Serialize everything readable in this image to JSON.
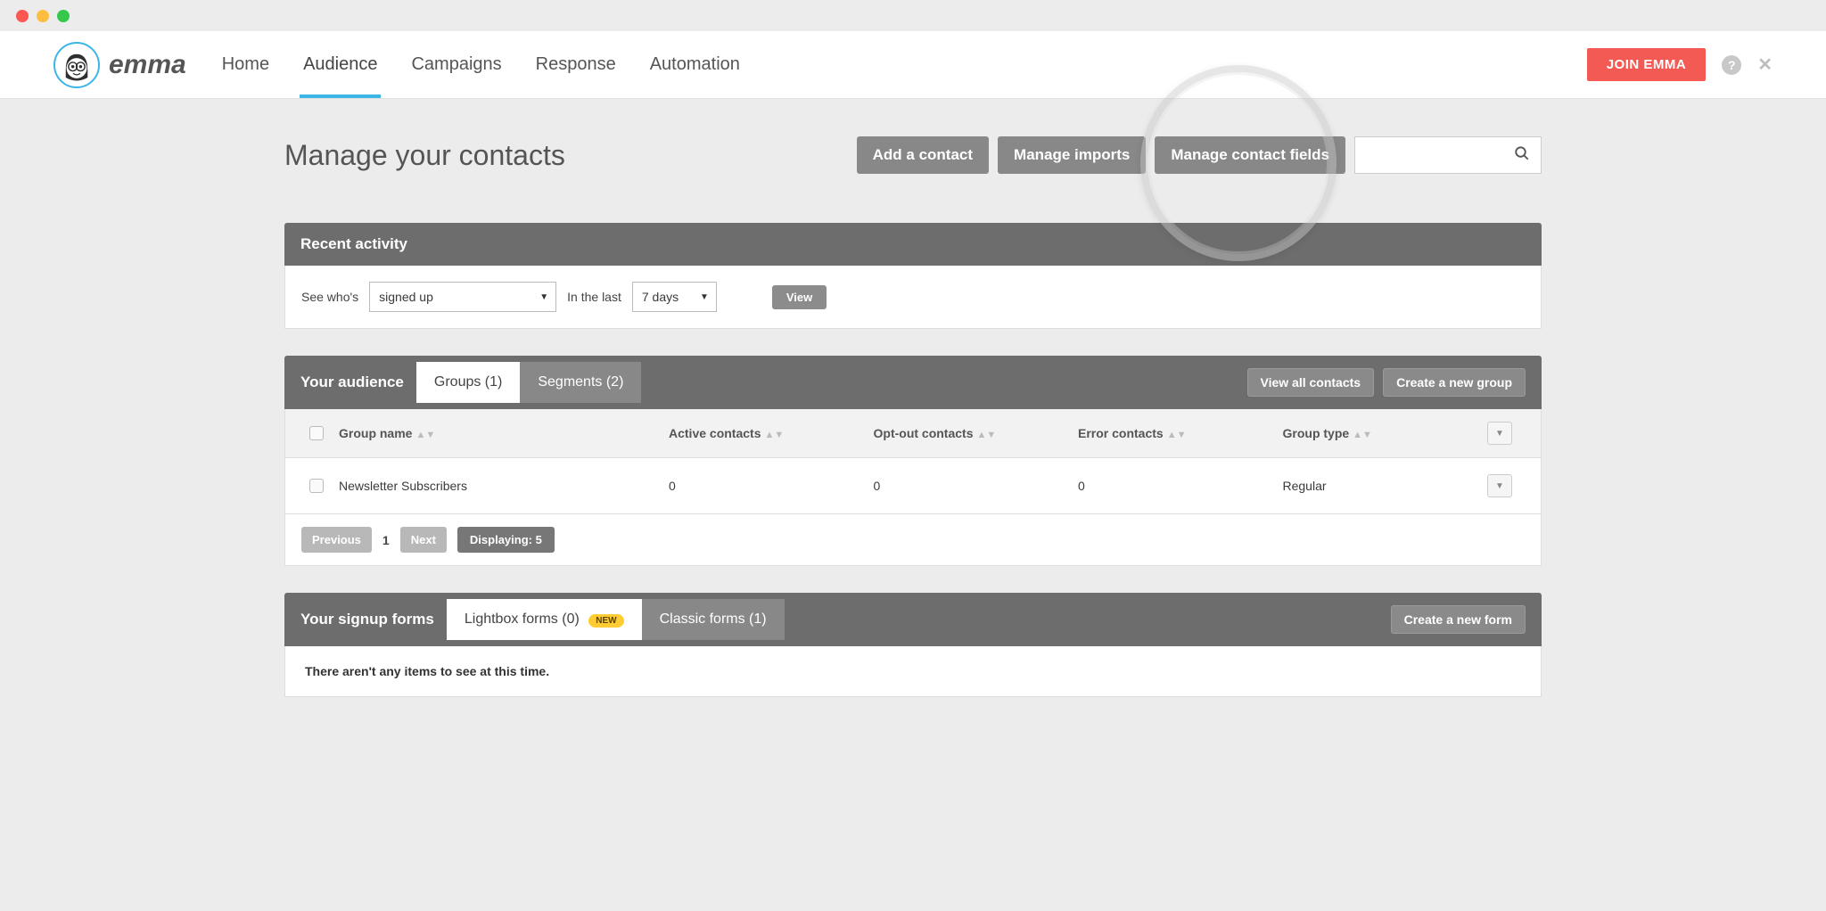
{
  "brand": {
    "name": "emma"
  },
  "nav": {
    "items": [
      "Home",
      "Audience",
      "Campaigns",
      "Response",
      "Automation"
    ],
    "activeIndex": 1,
    "join_label": "JOIN EMMA"
  },
  "page": {
    "title": "Manage your contacts",
    "actions": {
      "add_contact": "Add a contact",
      "manage_imports": "Manage imports",
      "manage_fields": "Manage contact fields"
    }
  },
  "recent": {
    "header": "Recent activity",
    "see_whos": "See who's",
    "action_value": "signed up",
    "in_last": "In the last",
    "range_value": "7 days",
    "view_label": "View"
  },
  "audience": {
    "header": "Your audience",
    "tabs": [
      {
        "label": "Groups (1)"
      },
      {
        "label": "Segments (2)"
      }
    ],
    "activeTab": 0,
    "view_all": "View all contacts",
    "create_group": "Create a new group",
    "columns": {
      "group_name": "Group name",
      "active": "Active contacts",
      "optout": "Opt-out contacts",
      "error": "Error contacts",
      "type": "Group type"
    },
    "rows": [
      {
        "name": "Newsletter Subscribers",
        "active": "0",
        "optout": "0",
        "error": "0",
        "type": "Regular"
      }
    ],
    "pagination": {
      "prev": "Previous",
      "page": "1",
      "next": "Next",
      "displaying": "Displaying: 5"
    }
  },
  "signup": {
    "header": "Your signup forms",
    "tabs": [
      {
        "label": "Lightbox forms (0)",
        "badge": "NEW"
      },
      {
        "label": "Classic forms (1)"
      }
    ],
    "activeTab": 0,
    "create_form": "Create a new form",
    "empty": "There aren't any items to see at this time."
  }
}
